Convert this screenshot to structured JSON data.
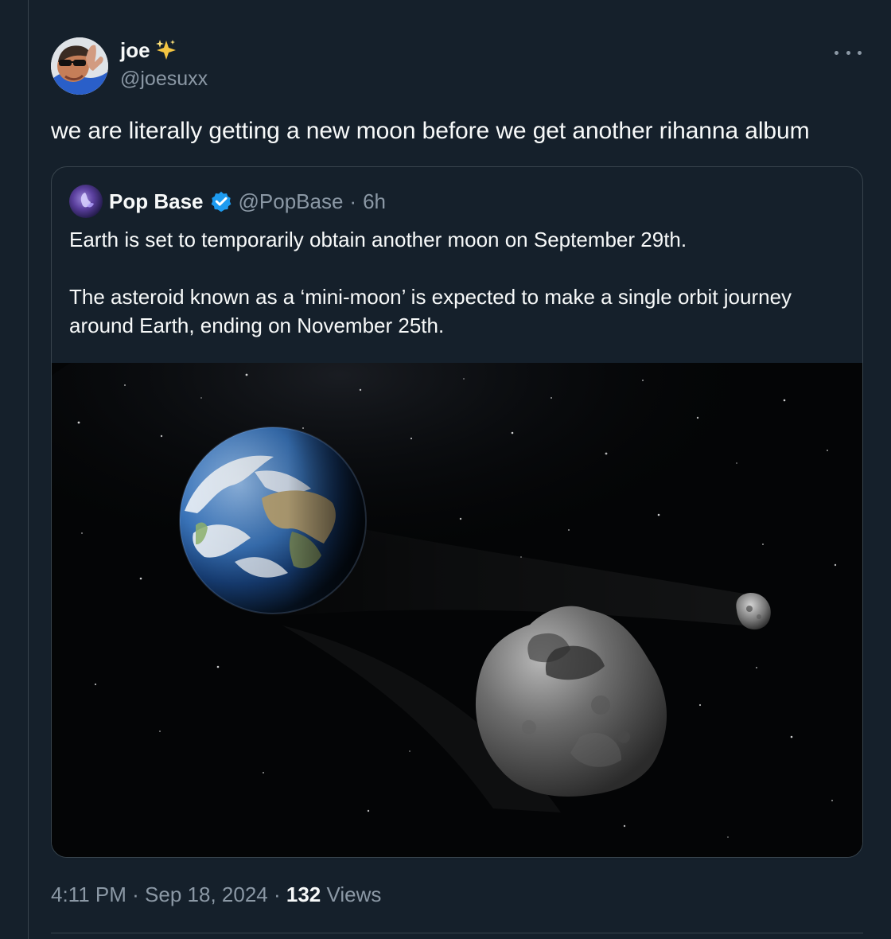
{
  "tweet": {
    "author": {
      "display_name": "joe",
      "handle": "@joesuxx",
      "avatar_icon": "profile-photo",
      "badge_icon": "sparkles-emoji"
    },
    "text": "we are literally getting a new moon before we get another rihanna album",
    "more_icon": "more-options-icon",
    "timestamp": {
      "time": "4:11 PM",
      "separator": "·",
      "date": "Sep 18, 2024",
      "views_count": "132",
      "views_label": "Views"
    }
  },
  "quoted_tweet": {
    "display_name": "Pop Base",
    "verified_icon": "verified-badge-icon",
    "handle": "@PopBase",
    "separator": "·",
    "age": "6h",
    "paragraphs": [
      "Earth is set to temporarily obtain another moon on September 29th.",
      "The asteroid known as a ‘mini-moon’ is expected to make a single orbit journey around Earth, ending on November 25th."
    ],
    "image": "space-illustration"
  },
  "colors": {
    "background": "#15202b",
    "text_primary": "#f7f9f9",
    "text_secondary": "#8b98a5",
    "border": "#38444d",
    "verified": "#1d9bf0",
    "sparkles": "#f4c542"
  }
}
